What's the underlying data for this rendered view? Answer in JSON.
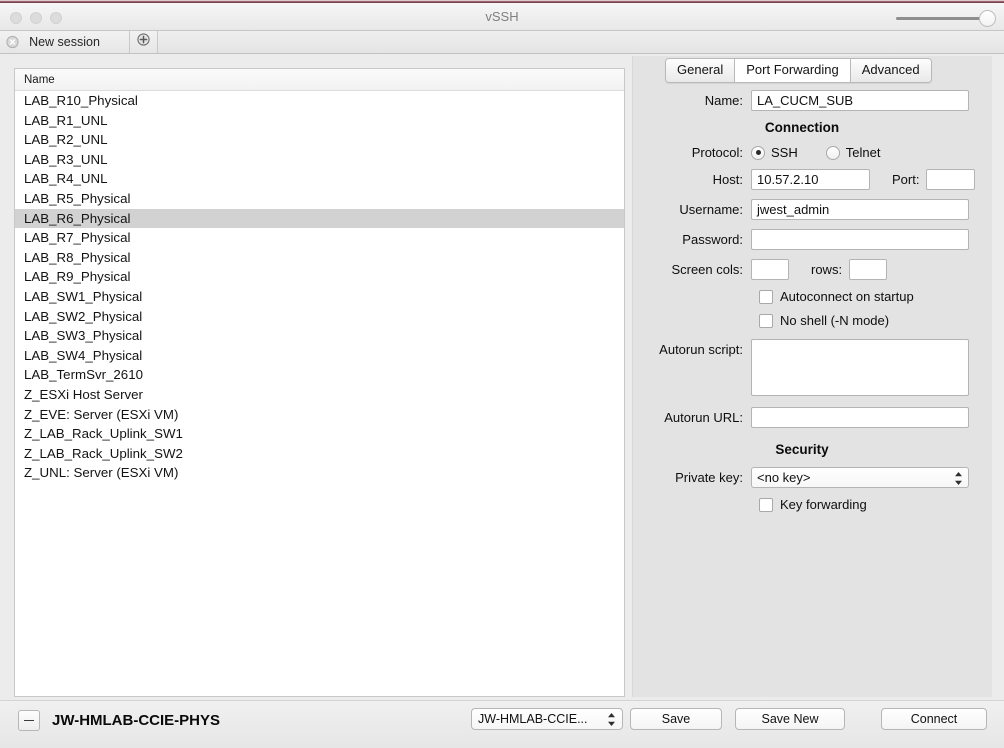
{
  "window": {
    "title": "vSSH",
    "traffic_lights": [
      "close",
      "minimize",
      "zoom"
    ],
    "slider_name": "title-slider"
  },
  "tabstrip": {
    "close_icon": "circle-x-icon",
    "session_label": "New session",
    "add_icon": "circle-plus-icon"
  },
  "list": {
    "header": "Name",
    "selected": "LAB_R6_Physical",
    "items": [
      "LAB_R10_Physical",
      "LAB_R1_UNL",
      "LAB_R2_UNL",
      "LAB_R3_UNL",
      "LAB_R4_UNL",
      "LAB_R5_Physical",
      "LAB_R6_Physical",
      "LAB_R7_Physical",
      "LAB_R8_Physical",
      "LAB_R9_Physical",
      "LAB_SW1_Physical",
      "LAB_SW2_Physical",
      "LAB_SW3_Physical",
      "LAB_SW4_Physical",
      "LAB_TermSvr_2610",
      "Z_ESXi Host Server",
      "Z_EVE: Server (ESXi VM)",
      "Z_LAB_Rack_Uplink_SW1",
      "Z_LAB_Rack_Uplink_SW2",
      "Z_UNL: Server (ESXi VM)"
    ]
  },
  "detail": {
    "tabs": [
      {
        "label": "General",
        "active": false
      },
      {
        "label": "Port Forwarding",
        "active": true
      },
      {
        "label": "Advanced",
        "active": false
      }
    ],
    "name_label": "Name:",
    "name_value": "LA_CUCM_SUB",
    "connection_heading": "Connection",
    "protocol_label": "Protocol:",
    "protocol_options": [
      {
        "label": "SSH",
        "selected": true
      },
      {
        "label": "Telnet",
        "selected": false
      }
    ],
    "host_label": "Host:",
    "host_value": "10.57.2.10",
    "port_label": "Port:",
    "port_value": "",
    "username_label": "Username:",
    "username_value": "jwest_admin",
    "password_label": "Password:",
    "password_value": "",
    "screen_cols_label": "Screen cols:",
    "screen_cols_value": "",
    "rows_label": "rows:",
    "rows_value": "",
    "autoconnect_label": "Autoconnect on startup",
    "autoconnect_checked": false,
    "noshell_label": "No shell (-N mode)",
    "noshell_checked": false,
    "autorun_script_label": "Autorun script:",
    "autorun_script_value": "",
    "autorun_url_label": "Autorun URL:",
    "autorun_url_value": "",
    "security_heading": "Security",
    "private_key_label": "Private key:",
    "private_key_value": "<no key>",
    "key_forwarding_label": "Key forwarding",
    "key_forwarding_checked": false
  },
  "bottom": {
    "remove_icon": "minus-icon",
    "group_name": "JW-HMLAB-CCIE-PHYS",
    "group_select_value": "JW-HMLAB-CCIE...",
    "save_label": "Save",
    "save_new_label": "Save New",
    "connect_label": "Connect"
  },
  "colors": {
    "panel_bg": "#e3e3e3",
    "list_bg": "#ffffff",
    "selection": "#d2d2d2",
    "chrome": "#ececec"
  }
}
